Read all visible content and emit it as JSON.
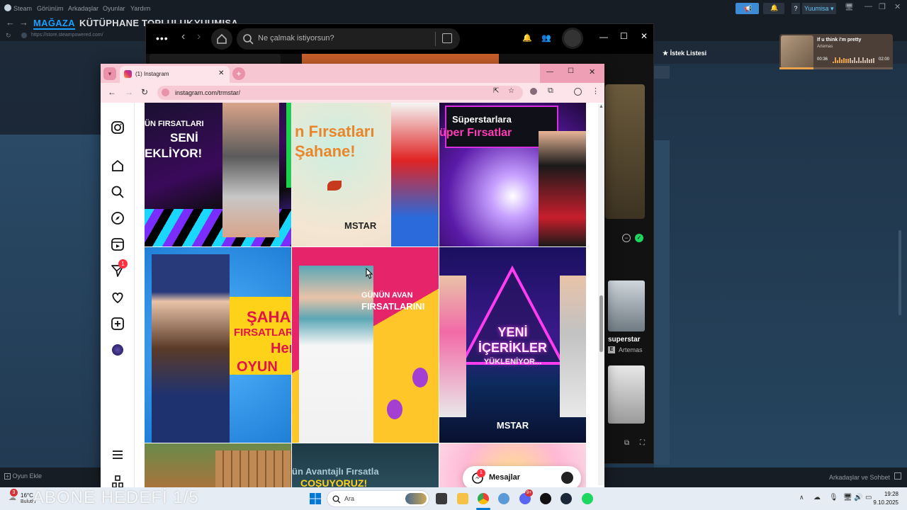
{
  "steam": {
    "menu": [
      "Steam",
      "Görünüm",
      "Arkadaşlar",
      "Oyunlar",
      "Yardım"
    ],
    "nav": [
      "MAĞAZA",
      "KÜTÜPHANE",
      "TOPLULUK",
      "YUUMISA"
    ],
    "url": "https://store.steampowered.com/",
    "user": "Yuumisa",
    "wishlist": "İstek Listesi",
    "add_game": "Oyun Ekle",
    "friends_chat": "Arkadaşlar ve Sohbet",
    "help": "?"
  },
  "media": {
    "title": "If u think i'm pretty",
    "artist": "Artemas",
    "elapsed": "00:36",
    "total": "02:00",
    "progress": 0.3
  },
  "spotify": {
    "search_placeholder": "Ne çalmak istiyorsun?",
    "card_title": "superstar",
    "card_artist": "Artemas",
    "explicit_badge": "E"
  },
  "browser": {
    "tab_title": "(1) Instagram",
    "url": "instagram.com/trmstar/"
  },
  "instagram": {
    "notification_count": "1",
    "messages_label": "Mesajlar",
    "messages_badge": "1",
    "posts": [
      {
        "lines": [
          "ÜN FIRSATLARI",
          "SENİ",
          "EKLİYOR!"
        ]
      },
      {
        "lines": [
          "n Fırsatları",
          "Şahane!"
        ],
        "logo": "MSTAR"
      },
      {
        "lines": [
          "Süperstarlara",
          "üper Fırsatlar"
        ]
      },
      {
        "lines": [
          "ŞAHA",
          "FIRSATLAR",
          "Her",
          "OYUN"
        ]
      },
      {
        "lines": [
          "GÜNÜN AVAN",
          "FIRSATLARINI"
        ]
      },
      {
        "lines": [
          "YENİ",
          "İÇERİKLER",
          "YÜKLENİYOR..."
        ],
        "logo": "MSTAR"
      },
      {
        "lines": []
      },
      {
        "lines": [
          "ün Avantajlı Fırsatla",
          "COŞUYORUZ!"
        ]
      },
      {
        "lines": []
      }
    ]
  },
  "taskbar": {
    "weather_temp": "16°C",
    "weather_desc": "Bulutlu",
    "weather_badge": "3",
    "overlay_text": "ABONE HEDEFİ 1/5",
    "search_placeholder": "Ara",
    "time": "19:28",
    "date": "9.10.2025",
    "discord_badge": "9+"
  }
}
